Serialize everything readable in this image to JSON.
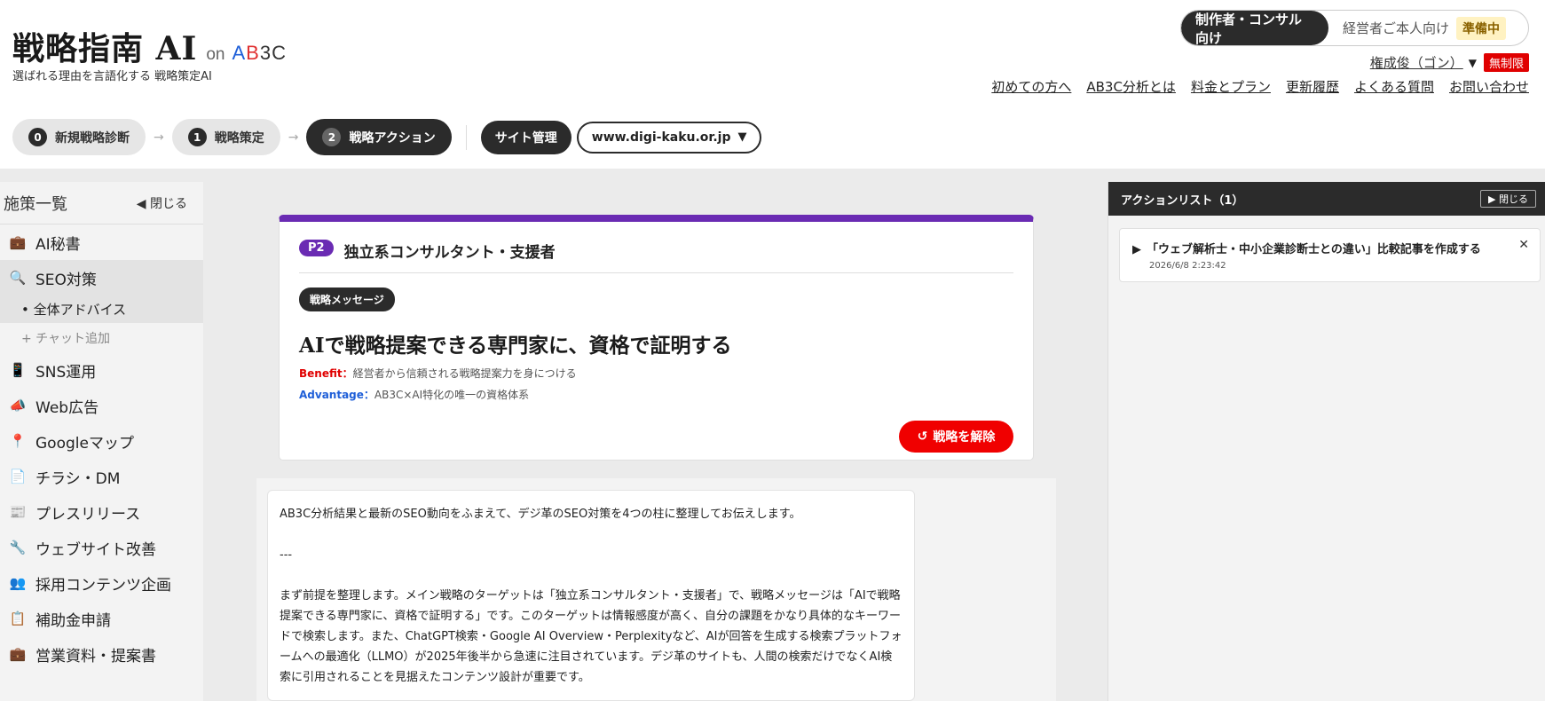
{
  "brand": {
    "title": "戦略指南 AI",
    "on": "on",
    "logo_a": "A",
    "logo_b": "B",
    "logo_c": "3C",
    "tagline": "選ばれる理由を言語化する 戦略策定AI"
  },
  "mode": {
    "active": "制作者・コンサル向け",
    "inactive": "経営者ご本人向け",
    "inactive_badge": "準備中"
  },
  "user": {
    "name": "権成俊（ゴン）",
    "plan": "無制限"
  },
  "top_links": [
    "初めての方へ",
    "AB3C分析とは",
    "料金とプラン",
    "更新履歴",
    "よくある質問",
    "お問い合わせ"
  ],
  "steps": [
    {
      "num": "0",
      "label": "新規戦略診断"
    },
    {
      "num": "1",
      "label": "戦略策定"
    },
    {
      "num": "2",
      "label": "戦略アクション"
    }
  ],
  "site_admin": "サイト管理",
  "domain": "www.digi-kaku.or.jp",
  "sidebar": {
    "title": "施策一覧",
    "close": "◀ 閉じる",
    "items": [
      {
        "icon": "💼",
        "label": "AI秘書"
      },
      {
        "icon": "🔍",
        "label": "SEO対策"
      },
      {
        "icon": "📱",
        "label": "SNS運用"
      },
      {
        "icon": "📣",
        "label": "Web広告"
      },
      {
        "icon": "📍",
        "label": "Googleマップ"
      },
      {
        "icon": "📄",
        "label": "チラシ・DM"
      },
      {
        "icon": "📰",
        "label": "プレスリリース"
      },
      {
        "icon": "🔧",
        "label": "ウェブサイト改善"
      },
      {
        "icon": "👥",
        "label": "採用コンテンツ企画"
      },
      {
        "icon": "📋",
        "label": "補助金申請"
      },
      {
        "icon": "💼",
        "label": "営業資料・提案書"
      }
    ],
    "sub_selected": "• 全体アドバイス",
    "sub_add": "+ チャット追加"
  },
  "card": {
    "badge": "P2",
    "target": "独立系コンサルタント・支援者",
    "msg_badge": "戦略メッセージ",
    "message": "AIで戦略提案できる専門家に、資格で証明する",
    "benefit_label": "Benefit：",
    "benefit": "経営者から信頼される戦略提案力を身につける",
    "advantage_label": "Advantage：",
    "advantage": "AB3C×AI特化の唯一の資格体系",
    "release_btn": "戦略を解除",
    "accent_color": "#6a2bb3"
  },
  "chat": {
    "p1": "AB3C分析結果と最新のSEO動向をふまえて、デジ革のSEO対策を4つの柱に整理してお伝えします。",
    "p2": "---",
    "p3": "まず前提を整理します。メイン戦略のターゲットは「独立系コンサルタント・支援者」で、戦略メッセージは「AIで戦略提案できる専門家に、資格で証明する」です。このターゲットは情報感度が高く、自分の課題をかなり具体的なキーワードで検索します。また、ChatGPT検索・Google AI Overview・Perplexityなど、AIが回答を生成する検索プラットフォームへの最適化（LLMO）が2025年後半から急速に注目されています。デジ革のサイトも、人間の検索だけでなくAI検索に引用されることを見据えたコンテンツ設計が重要です。"
  },
  "actions": {
    "title": "アクションリスト（1）",
    "close": "▶ 閉じる",
    "item_title": "「ウェブ解析士・中小企業診断士との違い」比較記事を作成する",
    "item_date": "2026/6/8 2:23:42"
  }
}
